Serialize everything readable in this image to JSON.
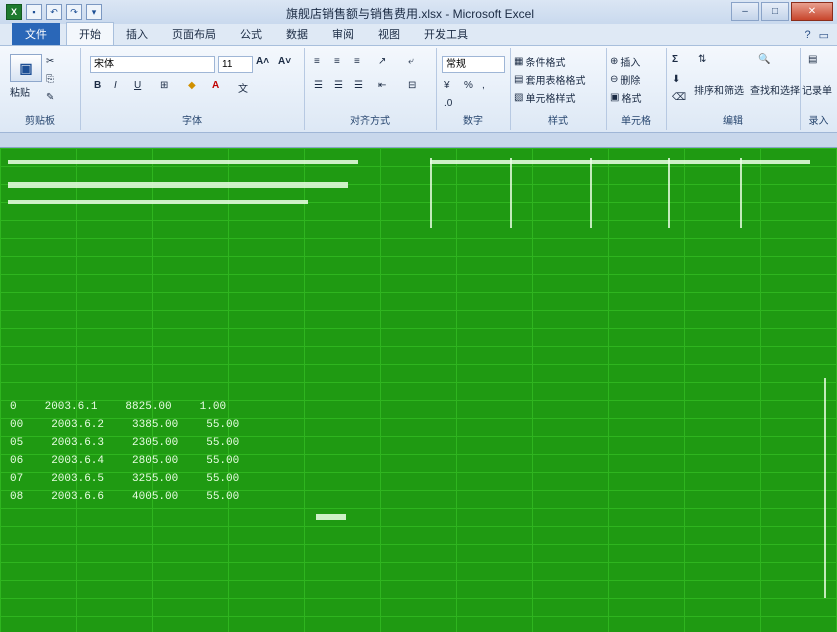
{
  "window": {
    "title": "旗舰店销售额与销售费用.xlsx - Microsoft Excel"
  },
  "tabs": [
    "文件",
    "开始",
    "插入",
    "页面布局",
    "公式",
    "数据",
    "审阅",
    "视图",
    "开发工具"
  ],
  "ribbon": {
    "clipboard": {
      "label": "剪贴板",
      "paste": "粘贴"
    },
    "font": {
      "label": "字体",
      "name": "宋体",
      "size": "11",
      "bold": "B",
      "italic": "I",
      "underline": "U"
    },
    "alignment": {
      "label": "对齐方式"
    },
    "number": {
      "label": "数字",
      "format": "常规",
      "percent": "%"
    },
    "styles": {
      "label": "样式",
      "conditional": "条件格式",
      "table_format": "套用表格格式",
      "cell_style": "单元格样式"
    },
    "cells": {
      "label": "单元格",
      "insert": "插入",
      "delete": "删除",
      "format": "格式"
    },
    "editing": {
      "label": "编辑",
      "sum": "Σ",
      "sort": "排序和筛选",
      "find": "查找和选择"
    },
    "extra": {
      "label": "录入",
      "record": "记录单"
    }
  },
  "sheet": {
    "rows": [
      {
        "row": "0",
        "date": "2003.6.1",
        "sales": "8825.00",
        "cost": "1.00"
      },
      {
        "row": "00",
        "date": "2003.6.2",
        "sales": "3385.00",
        "cost": "55.00"
      },
      {
        "row": "05",
        "date": "2003.6.3",
        "sales": "2305.00",
        "cost": "55.00"
      },
      {
        "row": "06",
        "date": "2003.6.4",
        "sales": "2805.00",
        "cost": "55.00"
      },
      {
        "row": "07",
        "date": "2003.6.5",
        "sales": "3255.00",
        "cost": "55.00"
      },
      {
        "row": "08",
        "date": "2003.6.6",
        "sales": "4005.00",
        "cost": "55.00"
      }
    ]
  }
}
